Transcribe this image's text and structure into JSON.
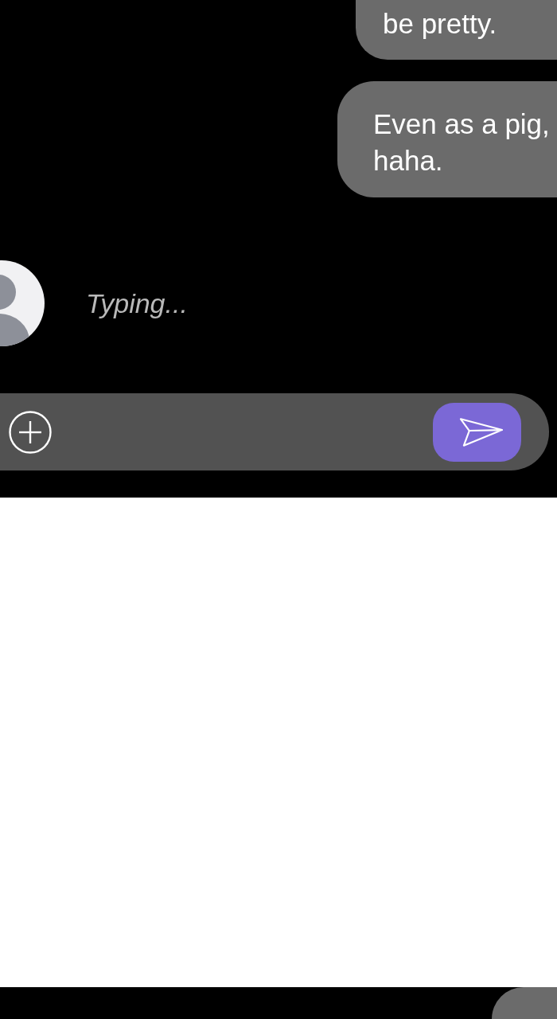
{
  "panels": [
    {
      "messages": [
        {
          "kind": "outgoing",
          "text": "be pretty."
        },
        {
          "kind": "outgoing",
          "text": "Even as a pig, haha."
        },
        {
          "kind": "typing",
          "text": "Typing..."
        }
      ],
      "composer": true
    },
    {
      "messages": [
        {
          "kind": "outgoing"
        }
      ]
    }
  ]
}
